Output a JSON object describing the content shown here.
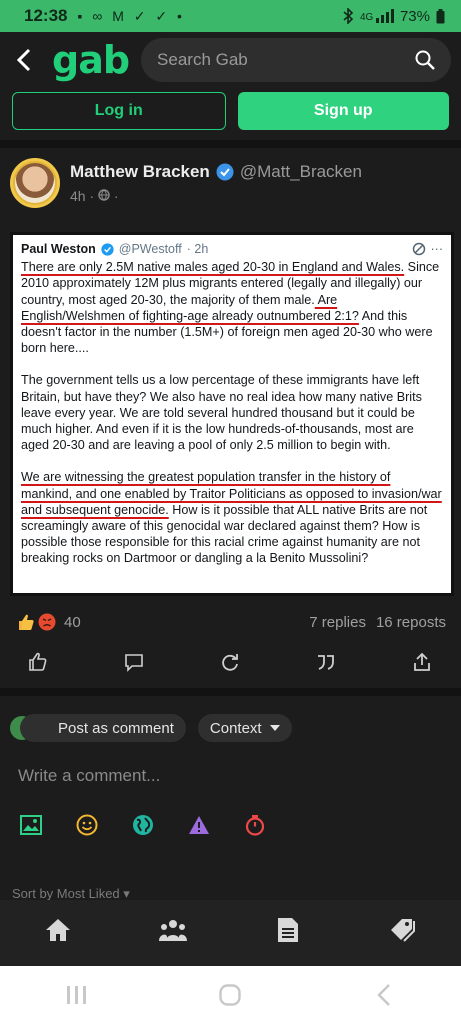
{
  "status_bar": {
    "time": "12:38",
    "left_icons": "▪ ∞ M ✓ ✓ •",
    "battery": "73%"
  },
  "header": {
    "logo": "gab",
    "search_placeholder": "Search Gab"
  },
  "auth": {
    "login_label": "Log in",
    "signup_label": "Sign up"
  },
  "post": {
    "author_name": "Matthew Bracken",
    "author_handle": "@Matt_Bracken",
    "time_ago": "4h",
    "tweet": {
      "author": "Paul Weston",
      "handle": "@PWestoff",
      "time": "· 2h",
      "p1_u1": "There are only 2.5M native males aged 20-30 in England and Wales.",
      "p1_t1": " Since 2010 approximately 12M plus migrants entered (legally and illegally) our country, most aged 20-30, the majority of them male.",
      "p1_u2": " Are English/Welshmen of fighting-age already outnumbered 2:1?",
      "p1_t2": " And this doesn't factor in the number (1.5M+) of foreign men aged 20-30 who were born here....",
      "p2": "The government tells us a low percentage of these immigrants have left Britain, but have they? We also have no real idea how many native Brits leave every year. We are told several hundred thousand but it could be much higher. And even if it is the low hundreds-of-thousands, most are aged 20-30 and are leaving a pool of only 2.5 million to begin with.",
      "p3_u": "We are witnessing the greatest population transfer in the history of mankind, and one enabled by Traitor Politicians as opposed to invasion/war and subsequent genocide.",
      "p3_t": " How is it possible that ALL native Brits are not screamingly aware of this genocidal war declared against them? How is possible those responsible for this racial crime against humanity are not breaking rocks on Dartmoor or dangling a la Benito Mussolini?"
    },
    "reaction_count": "40",
    "replies": "7 replies",
    "reposts": "16 reposts"
  },
  "comment": {
    "post_as_label": "Post as comment",
    "context_label": "Context",
    "placeholder": "Write a comment...",
    "sort_label": "Sort by Most Liked ▾"
  },
  "colors": {
    "brand": "#21cf7a",
    "status_bar": "#3cb86a",
    "underline": "#d3161a",
    "background": "#1c1c1c"
  },
  "icons": {
    "status": [
      "signal-icon",
      "battery-icon"
    ],
    "tools": [
      "image-icon",
      "emoji-icon",
      "globe-icon",
      "warning-icon",
      "timer-icon"
    ],
    "nav": [
      "home-icon",
      "groups-icon",
      "news-icon",
      "tags-icon"
    ]
  }
}
